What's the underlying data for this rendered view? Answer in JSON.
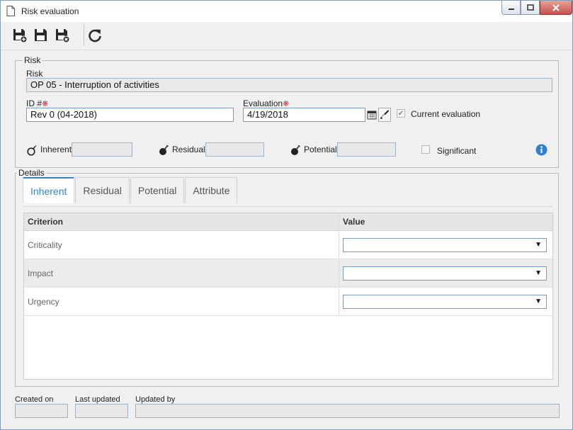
{
  "window": {
    "title": "Risk evaluation"
  },
  "icons": {
    "document": "document-icon",
    "save_new": "save-and-new-icon",
    "save": "save-icon",
    "save_close": "save-and-close-icon",
    "refresh": "refresh-icon",
    "calendar": "calendar-icon",
    "clear": "brush-icon",
    "info": "info-icon"
  },
  "colors": {
    "accent": "#3a83c7",
    "required": "#dd3333",
    "close": "#c75050"
  },
  "risk_section": {
    "legend": "Risk",
    "risk_label": "Risk",
    "risk_value": "OP 05 - Interruption of activities",
    "id_label": "ID #",
    "id_value": "Rev 0 (04-2018)",
    "evaluation_label": "Evaluation",
    "evaluation_value": "4/19/2018",
    "current_evaluation_label": "Current evaluation",
    "current_evaluation_checked": true,
    "inherent_label": "Inherent",
    "residual_label": "Residual",
    "potential_label": "Potential",
    "significant_label": "Significant",
    "significant_checked": false
  },
  "details": {
    "legend": "Details",
    "tabs": [
      {
        "label": "Inherent",
        "active": true
      },
      {
        "label": "Residual",
        "active": false
      },
      {
        "label": "Potential",
        "active": false
      },
      {
        "label": "Attribute",
        "active": false
      }
    ],
    "columns": {
      "criterion": "Criterion",
      "value": "Value"
    },
    "rows": [
      {
        "criterion": "Criticality",
        "value": ""
      },
      {
        "criterion": "Impact",
        "value": ""
      },
      {
        "criterion": "Urgency",
        "value": ""
      }
    ],
    "dropdown_arrow": "▼"
  },
  "footer": {
    "created_on_label": "Created on",
    "last_updated_label": "Last updated",
    "updated_by_label": "Updated by"
  }
}
